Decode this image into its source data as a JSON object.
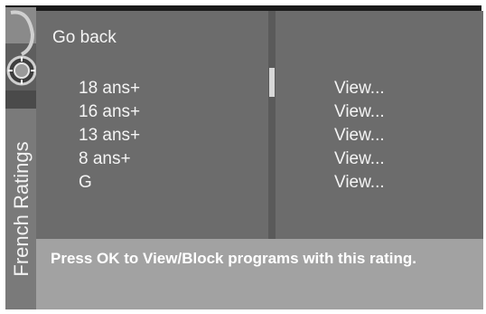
{
  "sidebar": {
    "title": "French Ratings",
    "image": "safe-dial-icon"
  },
  "menu": {
    "back_label": "Go back",
    "ratings": [
      {
        "name": "18 ans+",
        "action": "View..."
      },
      {
        "name": "16 ans+",
        "action": "View..."
      },
      {
        "name": "13 ans+",
        "action": "View..."
      },
      {
        "name": "8 ans+",
        "action": "View..."
      },
      {
        "name": "G",
        "action": "View..."
      }
    ]
  },
  "help": {
    "text": "Press OK to View/Block programs with this rating."
  },
  "colors": {
    "panel": "#6c6c6c",
    "help_bar": "#a2a2a2",
    "sidebar": "#7a7a7a",
    "text": "#f4f4f4"
  }
}
